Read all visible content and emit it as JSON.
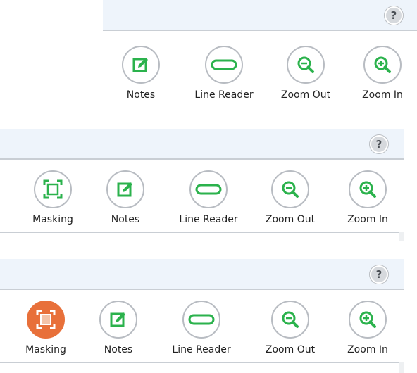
{
  "help_icon_glyph": "?",
  "colors": {
    "accent_green": "#2bb24c",
    "active_orange": "#e8703a",
    "header_bg": "#eef4fb"
  },
  "panels": [
    {
      "tools": [
        {
          "label": "Notes",
          "icon": "notes-icon"
        },
        {
          "label": "Line Reader",
          "icon": "line-reader-icon"
        },
        {
          "label": "Zoom Out",
          "icon": "zoom-out-icon"
        },
        {
          "label": "Zoom In",
          "icon": "zoom-in-icon"
        }
      ]
    },
    {
      "tools": [
        {
          "label": "Masking",
          "icon": "masking-icon"
        },
        {
          "label": "Notes",
          "icon": "notes-icon"
        },
        {
          "label": "Line Reader",
          "icon": "line-reader-icon"
        },
        {
          "label": "Zoom Out",
          "icon": "zoom-out-icon"
        },
        {
          "label": "Zoom In",
          "icon": "zoom-in-icon"
        }
      ]
    },
    {
      "tools": [
        {
          "label": "Masking",
          "icon": "masking-icon",
          "active": true
        },
        {
          "label": "Notes",
          "icon": "notes-icon"
        },
        {
          "label": "Line Reader",
          "icon": "line-reader-icon"
        },
        {
          "label": "Zoom Out",
          "icon": "zoom-out-icon"
        },
        {
          "label": "Zoom In",
          "icon": "zoom-in-icon"
        }
      ]
    }
  ]
}
